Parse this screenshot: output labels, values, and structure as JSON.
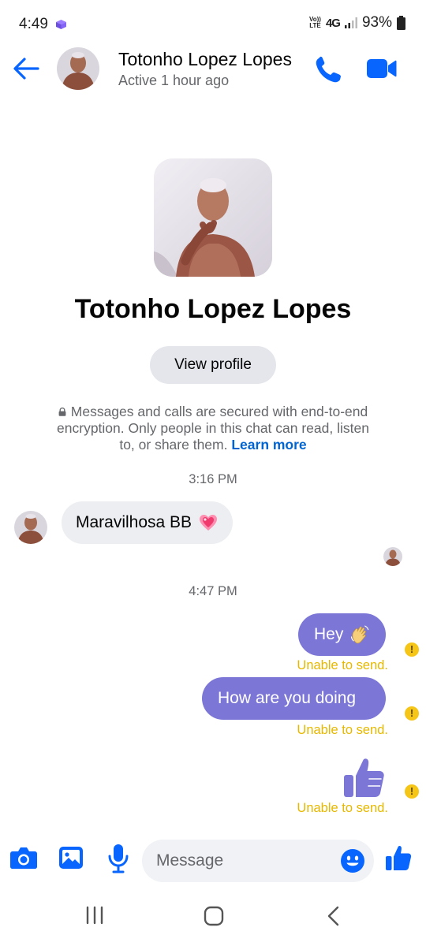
{
  "status_bar": {
    "time": "4:49",
    "volte_top": "Vo))",
    "volte_bottom": "LTE",
    "network": "4G",
    "battery": "93%"
  },
  "header": {
    "contact_name": "Totonho Lopez Lopes",
    "active_status": "Active 1 hour ago"
  },
  "intro": {
    "name": "Totonho Lopez Lopes",
    "view_profile_label": "View profile",
    "encryption_notice": "Messages and calls are secured with end-to-end encryption. Only people in this chat can read, listen to, or share them.",
    "learn_more_label": "Learn more"
  },
  "messages": {
    "time_1": "3:16 PM",
    "incoming_1": "Maravilhosa BB",
    "time_2": "4:47 PM",
    "outgoing_1": "Hey",
    "outgoing_2": "How are you doing",
    "error_text_1": "Unable to send.",
    "error_text_2": "Unable to send.",
    "error_text_3": "Unable to send.",
    "error_mark": "!"
  },
  "composer": {
    "placeholder": "Message"
  },
  "icons": {
    "back": "arrow-left-icon",
    "call": "phone-icon",
    "video": "video-camera-icon",
    "camera": "camera-icon",
    "gallery": "image-icon",
    "mic": "microphone-icon",
    "emoji": "smiley-icon",
    "like": "thumbs-up-icon"
  },
  "colors": {
    "accent": "#0866ff",
    "outgoing_bubble": "#7c76d6",
    "error": "#f5c518"
  }
}
